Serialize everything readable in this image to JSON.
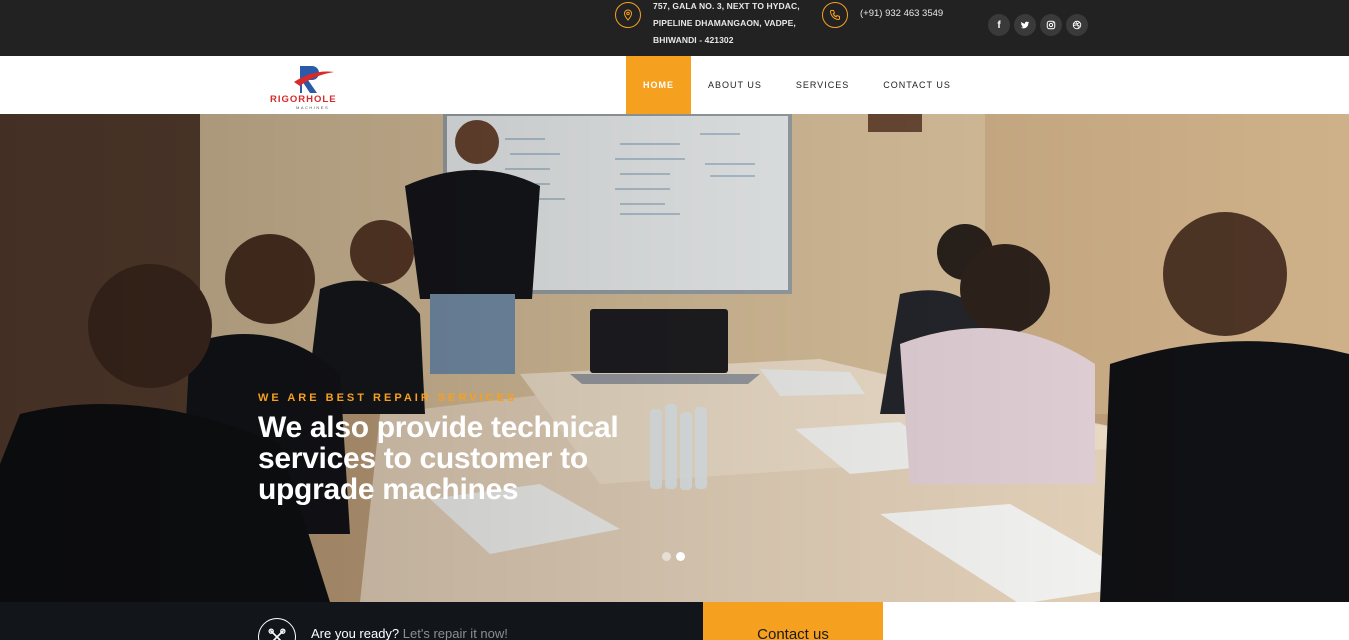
{
  "topbar": {
    "address_lines": [
      "757, GALA NO. 3, NEXT TO HYDAC,",
      "PIPELINE DHAMANGAON, VADPE,",
      "BHIWANDI - 421302"
    ],
    "phone": "(+91) 932 463 3549",
    "socials": [
      "facebook-icon",
      "twitter-icon",
      "instagram-icon",
      "dribbble-icon"
    ]
  },
  "brand": {
    "name": "RIGORHOLE",
    "tagline": "MACHINES"
  },
  "nav": {
    "items": [
      {
        "label": "HOME",
        "active": true
      },
      {
        "label": "ABOUT US",
        "active": false
      },
      {
        "label": "SERVICES",
        "active": false
      },
      {
        "label": "CONTACT US",
        "active": false
      }
    ]
  },
  "hero": {
    "eyebrow": "WE ARE BEST REPAIR SERVICES",
    "title": "We also provide technical services to customer to upgrade machines",
    "slides": 2,
    "active_slide": 2
  },
  "cta": {
    "question": "Are you ready?",
    "subtext": "Let's repair it now!",
    "button": "Contact us"
  },
  "colors": {
    "accent": "#f6a020",
    "topbar": "#222222",
    "dark": "#12151a",
    "brand_red": "#d72a2a"
  }
}
